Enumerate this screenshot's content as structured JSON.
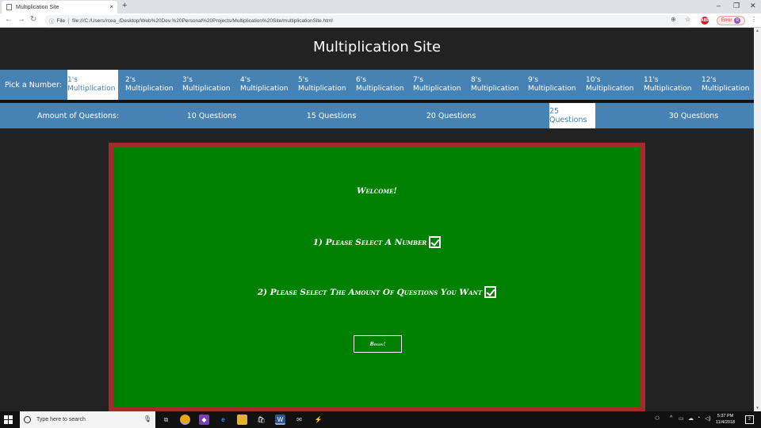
{
  "browser": {
    "tab_title": "Multiplication Site",
    "tab_close": "×",
    "new_tab": "+",
    "url_prefix": "File",
    "url": "file:///C:/Users/rcea_/Desktop/Web%20Dev.%20Personal%20Projects/Multiplication%20Site/multiplicationSite.html",
    "adblock_label": "ABP",
    "error_label": "Error",
    "avatar_initial": "R"
  },
  "page": {
    "title": "Multiplication Site",
    "pick_label": "Pick a Number:",
    "numbers": [
      {
        "num": "1's",
        "word": "Multiplication",
        "active": true
      },
      {
        "num": "2's",
        "word": "Multiplication",
        "active": false
      },
      {
        "num": "3's",
        "word": "Multiplication",
        "active": false
      },
      {
        "num": "4's",
        "word": "Multiplication",
        "active": false
      },
      {
        "num": "5's",
        "word": "Multiplication",
        "active": false
      },
      {
        "num": "6's",
        "word": "Multiplication",
        "active": false
      },
      {
        "num": "7's",
        "word": "Multiplication",
        "active": false
      },
      {
        "num": "8's",
        "word": "Multiplication",
        "active": false
      },
      {
        "num": "9's",
        "word": "Multiplication",
        "active": false
      },
      {
        "num": "10's",
        "word": "Multiplication",
        "active": false
      },
      {
        "num": "11's",
        "word": "Multiplication",
        "active": false
      },
      {
        "num": "12's",
        "word": "Multiplication",
        "active": false
      }
    ],
    "amount_label": "Amount of Questions:",
    "question_options": [
      {
        "label": "10 Questions",
        "active": false
      },
      {
        "label": "15 Questions",
        "active": false
      },
      {
        "label": "20 Questions",
        "active": false
      },
      {
        "label": "25 Questions",
        "active": true
      },
      {
        "label": "30 Questions",
        "active": false
      }
    ],
    "board": {
      "welcome": "Welcome!",
      "step1": "1) Please Select A Number",
      "step2": "2) Please Select The Amount Of Questions You Want",
      "begin": "Begin!"
    },
    "colors": {
      "nav_blue": "#4682b4",
      "board_green": "#008000",
      "board_border": "#a52a2a",
      "background": "#222222"
    }
  },
  "taskbar": {
    "search_placeholder": "Type here to search",
    "time": "5:37 PM",
    "date": "11/4/2018",
    "notifications": "2"
  }
}
